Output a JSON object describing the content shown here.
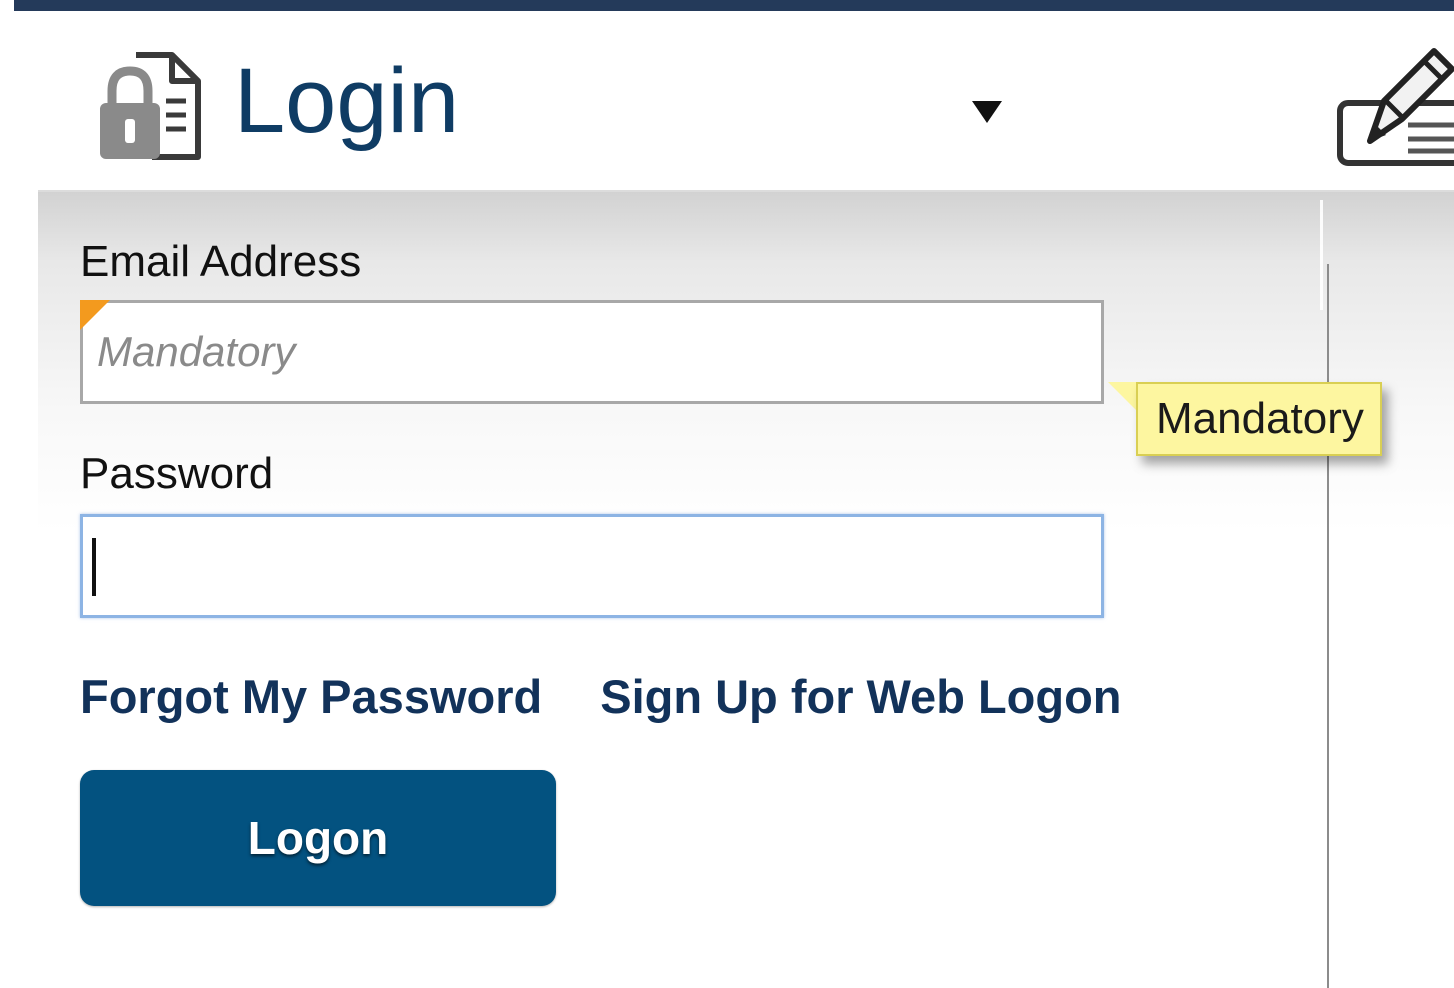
{
  "header": {
    "title": "Login",
    "icon": "lock-document-icon",
    "menu_icon": "dropdown-arrow-icon",
    "right_icon": "edit-form-icon"
  },
  "form": {
    "email_label": "Email Address",
    "email_placeholder": "Mandatory",
    "email_value": "",
    "email_tooltip": "Mandatory",
    "password_label": "Password",
    "password_value": "",
    "forgot_password_link": "Forgot My Password",
    "signup_link": "Sign Up for Web Logon",
    "logon_button": "Logon"
  },
  "colors": {
    "title": "#0f3c64",
    "top_rule": "#243a5a",
    "button": "#035280",
    "link": "#12325a",
    "tooltip_bg": "#fdf6a0",
    "mandatory_flag": "#f39a1e",
    "focus_border": "#8db4e4"
  }
}
